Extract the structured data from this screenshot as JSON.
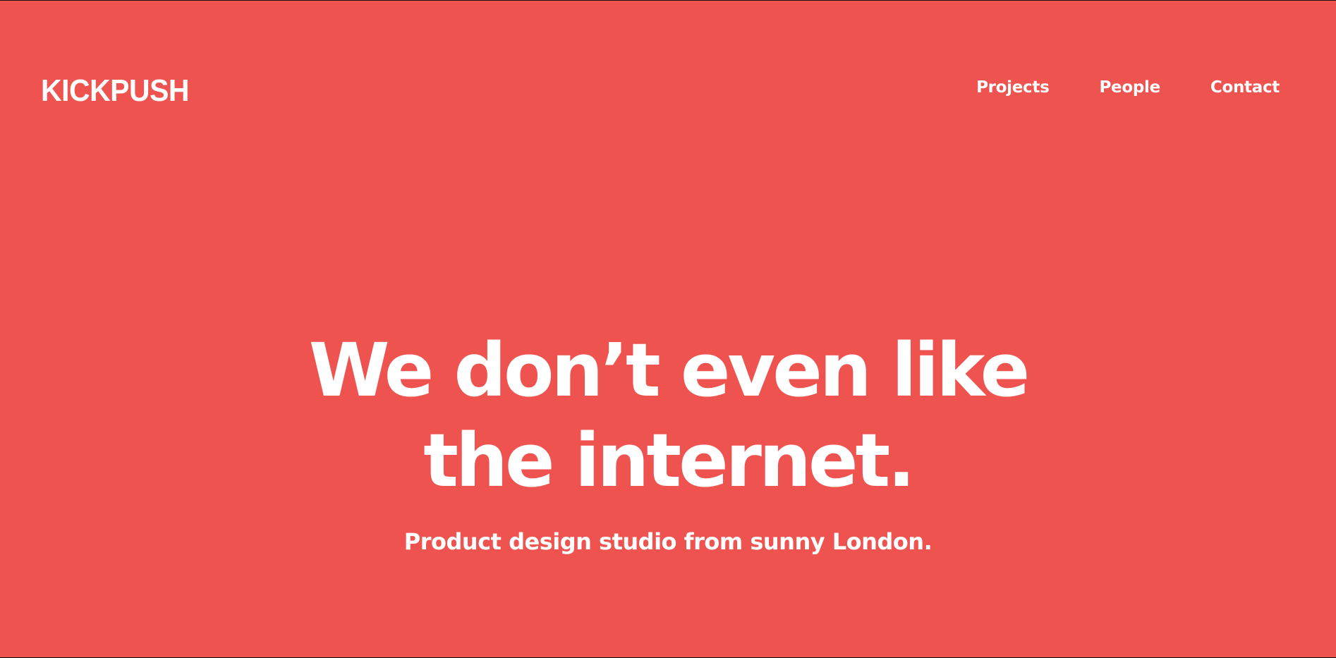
{
  "brand": {
    "logo_text": "KICKPUSH",
    "background_color": "#EF5350",
    "text_color": "#FFFFFF"
  },
  "nav": {
    "items": [
      {
        "label": "Projects"
      },
      {
        "label": "People"
      },
      {
        "label": "Contact"
      }
    ]
  },
  "hero": {
    "headline_line1": "We don’t even like",
    "headline_line2": "the internet.",
    "subheadline": "Product design studio from sunny London."
  }
}
